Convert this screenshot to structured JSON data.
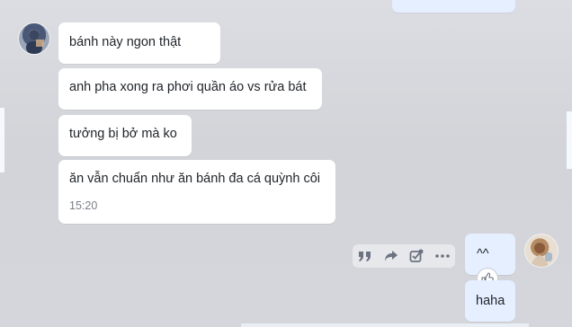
{
  "messages_in": [
    {
      "text": "bánh này ngon thật"
    },
    {
      "text": "anh pha xong ra phơi quần áo vs rửa bát"
    },
    {
      "text": "tưởng bị bở mà ko"
    },
    {
      "text": "ăn vẫn chuẩn như ăn bánh đa cá quỳnh côi",
      "time": "15:20"
    }
  ],
  "messages_out": [
    {
      "text": "^^"
    },
    {
      "text": "haha"
    }
  ],
  "toolbar": {
    "icons": [
      "quote-icon",
      "forward-icon",
      "task-icon",
      "more-icon"
    ]
  },
  "reaction": {
    "icon": "thumbs-up-icon"
  },
  "colors": {
    "incoming_bubble": "#ffffff",
    "outgoing_bubble": "#e5efff",
    "background": "#d4d6dc"
  }
}
